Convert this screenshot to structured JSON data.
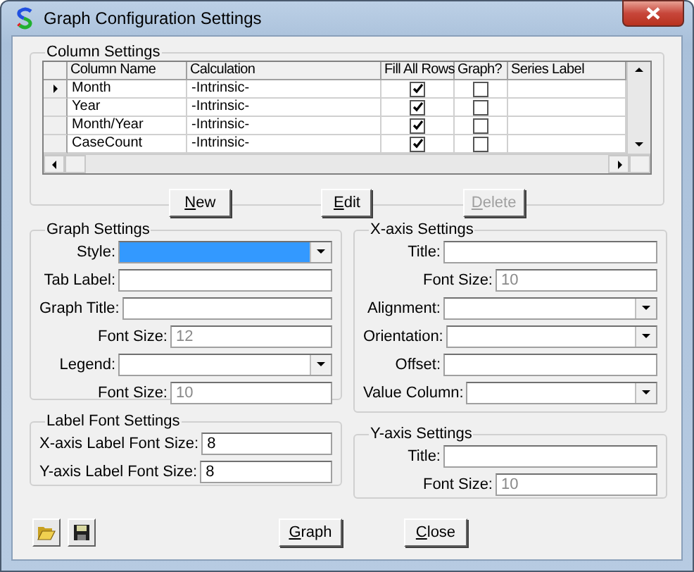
{
  "window": {
    "title": "Graph Configuration Settings"
  },
  "column_settings": {
    "title": "Column Settings",
    "columns": [
      "Column Name",
      "Calculation",
      "Fill All Rows",
      "Graph?",
      "Series Label"
    ],
    "rows": [
      {
        "name": "Month",
        "calculation": "-Intrinsic-",
        "fill_all_rows": true,
        "graph": false,
        "selected": true
      },
      {
        "name": "Year",
        "calculation": "-Intrinsic-",
        "fill_all_rows": true,
        "graph": false,
        "selected": false
      },
      {
        "name": "Month/Year",
        "calculation": "-Intrinsic-",
        "fill_all_rows": true,
        "graph": false,
        "selected": false
      },
      {
        "name": "CaseCount",
        "calculation": "-Intrinsic-",
        "fill_all_rows": true,
        "graph": false,
        "selected": false
      }
    ],
    "buttons": [
      {
        "label": "New",
        "disabled": false
      },
      {
        "label": "Edit",
        "disabled": false
      },
      {
        "label": "Delete",
        "disabled": true
      }
    ]
  },
  "graph_settings": {
    "title": "Graph Settings",
    "fields": [
      {
        "kind": "dropdown",
        "label": "Style:",
        "highlighted": true
      },
      {
        "kind": "text",
        "label": "Tab Label:"
      },
      {
        "kind": "text",
        "label": "Graph Title:"
      },
      {
        "kind": "sub",
        "label": "Font Size:",
        "value": "12",
        "disabled": true
      },
      {
        "kind": "dropdown",
        "label": "Legend:",
        "highlighted": false
      },
      {
        "kind": "sub",
        "label": "Font Size:",
        "value": "10",
        "disabled": true
      }
    ]
  },
  "label_font_settings": {
    "title": "Label Font Settings",
    "fields": [
      {
        "kind": "text",
        "label": "X-axis Label Font Size:",
        "value": "8"
      },
      {
        "kind": "text",
        "label": "Y-axis Label Font Size:",
        "value": "8"
      }
    ]
  },
  "x_axis_settings": {
    "title": "X-axis Settings",
    "fields": [
      {
        "kind": "text",
        "label": "Title:"
      },
      {
        "kind": "sub",
        "label": "Font Size:",
        "value": "10",
        "disabled": true
      },
      {
        "kind": "dropdown",
        "label": "Alignment:",
        "highlighted": false
      },
      {
        "kind": "dropdown",
        "label": "Orientation:",
        "highlighted": false
      },
      {
        "kind": "text",
        "label": "Offset:"
      },
      {
        "kind": "dropdown",
        "label": "Value Column:",
        "highlighted": false
      }
    ]
  },
  "y_axis_settings": {
    "title": "Y-axis Settings",
    "fields": [
      {
        "kind": "text",
        "label": "Title:"
      },
      {
        "kind": "sub",
        "label": "Font Size:",
        "value": "10",
        "disabled": true
      }
    ]
  },
  "footer": {
    "buttons": [
      {
        "label": "Graph"
      },
      {
        "label": "Close"
      }
    ]
  }
}
